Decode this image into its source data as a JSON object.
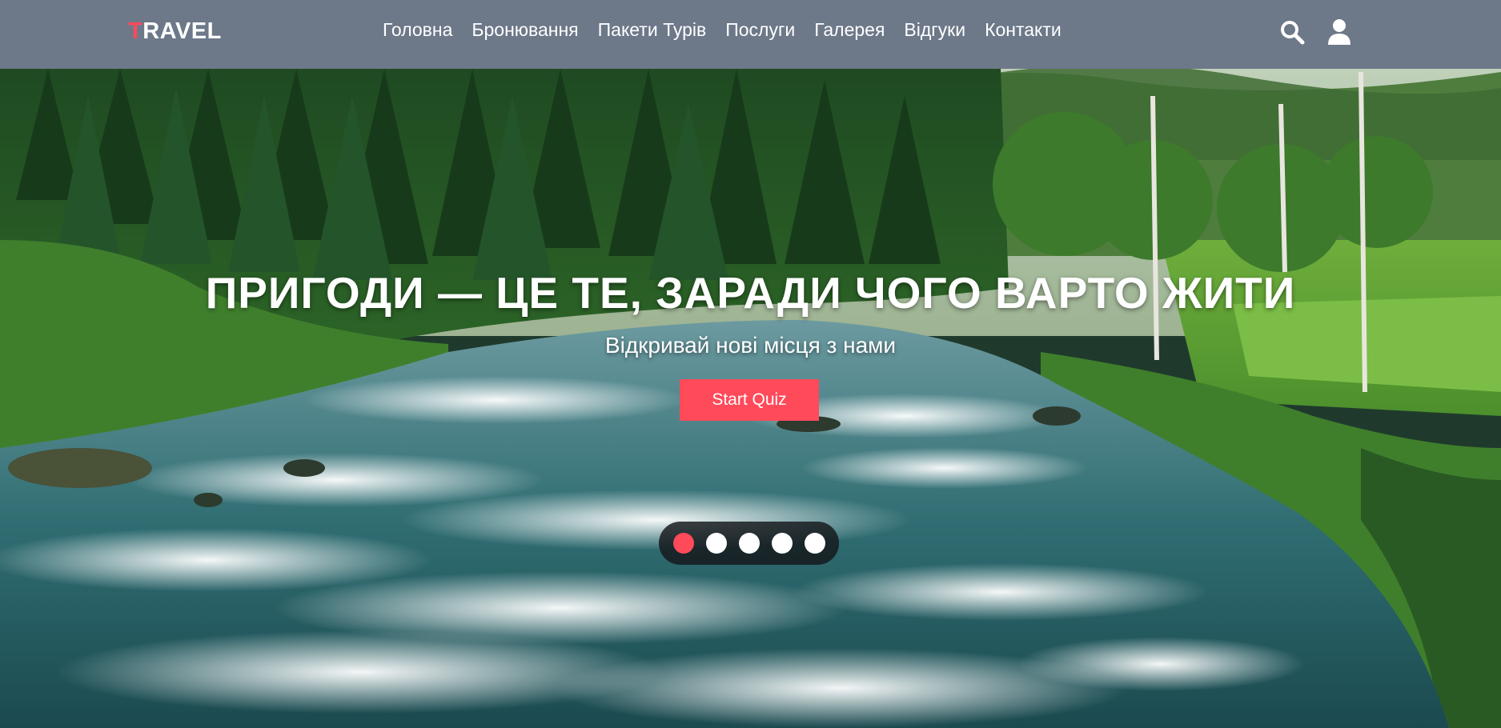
{
  "header": {
    "logo_first": "T",
    "logo_rest": "RAVEL",
    "nav": [
      {
        "label": "Головна"
      },
      {
        "label": "Бронювання"
      },
      {
        "label": "Пакети Турів"
      },
      {
        "label": "Послуги"
      },
      {
        "label": "Галерея"
      },
      {
        "label": "Відгуки"
      },
      {
        "label": "Контакти"
      }
    ],
    "icons": [
      "search-icon",
      "user-icon"
    ]
  },
  "hero": {
    "title": "ПРИГОДИ — ЦЕ ТЕ, ЗАРАДИ ЧОГО ВАРТО ЖИТИ",
    "subtitle": "Відкривай нові місця з нами",
    "cta_label": "Start Quiz"
  },
  "slider": {
    "dot_count": 5,
    "active_index": 0
  },
  "colors": {
    "header_bg": "#6d7889",
    "accent": "#ff4a5a",
    "text": "#ffffff"
  }
}
